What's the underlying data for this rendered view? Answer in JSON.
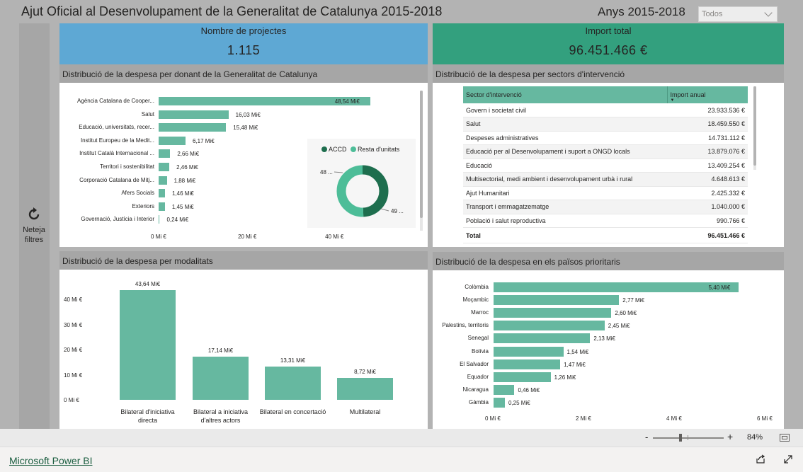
{
  "header": {
    "title": "Ajut Oficial al Desenvolupament de la Generalitat de Catalunya 2015-2018",
    "years_label": "Anys 2015-2018",
    "slicer_value": "Todos"
  },
  "reset": {
    "label_line1": "Neteja",
    "label_line2": "filtres",
    "icon": "refresh-icon"
  },
  "kpis": {
    "projects": {
      "title": "Nombre de projectes",
      "value": "1.115",
      "color": "#5ea8d4"
    },
    "total": {
      "title": "Import total",
      "value": "96.451.466 €",
      "color": "#33a07e"
    }
  },
  "sections": {
    "donors": "Distribució de la despesa per donant de la Generalitat de Catalunya",
    "sectors": "Distribució de la despesa per sectors d'intervenció",
    "modalities": "Distribució de la despesa per modalitats",
    "countries": "Distribució de la despesa en els països prioritaris"
  },
  "chart_data": [
    {
      "type": "bar",
      "orientation": "horizontal",
      "categories": [
        "Agència Catalana de Cooper...",
        "Salut",
        "Educació, universitats, recer...",
        "Institut Europeu de la Medit...",
        "Institut Català Internacional ...",
        "Territori i sostenibilitat",
        "Corporació Catalana de Mitj...",
        "Afers Socials",
        "Exteriors",
        "Governació, Justícia i Interior"
      ],
      "values": [
        48.54,
        16.03,
        15.48,
        6.17,
        2.66,
        2.46,
        1.88,
        1.46,
        1.45,
        0.24
      ],
      "value_labels": [
        "48,54 Mi€",
        "16,03 Mi€",
        "15,48 Mi€",
        "6,17 Mi€",
        "2,66 Mi€",
        "2,46 Mi€",
        "1,88 Mi€",
        "1,46 Mi€",
        "1,45 Mi€",
        "0,24 Mi€"
      ],
      "xticks": [
        "0 Mi €",
        "20 Mi €",
        "40 Mi €"
      ],
      "xlim": [
        0,
        52
      ]
    },
    {
      "type": "pie",
      "variant": "donut",
      "legend": [
        "ACCD",
        "Resta d'unitats"
      ],
      "values": [
        48,
        49
      ],
      "value_labels": [
        "48 ...",
        "49 ..."
      ],
      "colors": [
        "#1e6e4e",
        "#4dbd98"
      ]
    },
    {
      "type": "bar",
      "orientation": "vertical",
      "categories": [
        [
          "Bilateral d'iniciativa",
          "directa"
        ],
        [
          "Bilateral a iniciativa",
          "d'altres actors"
        ],
        [
          "Bilateral en concertació"
        ],
        [
          "Multilateral"
        ]
      ],
      "values": [
        43.64,
        17.14,
        13.31,
        8.72
      ],
      "value_labels": [
        "43,64 Mi€",
        "17,14 Mi€",
        "13,31 Mi€",
        "8,72 Mi€"
      ],
      "yticks": [
        "40 Mi €",
        "30 Mi €",
        "20 Mi €",
        "10 Mi €",
        "0 Mi €"
      ],
      "ylim": [
        0,
        45
      ]
    },
    {
      "type": "bar",
      "orientation": "horizontal",
      "categories": [
        "Colòmbia",
        "Moçambic",
        "Marroc",
        "Palestins, territoris",
        "Senegal",
        "Bolívia",
        "El Salvador",
        "Equador",
        "Nicaragua",
        "Gàmbia"
      ],
      "values": [
        5.4,
        2.77,
        2.6,
        2.45,
        2.13,
        1.54,
        1.47,
        1.26,
        0.46,
        0.25
      ],
      "value_labels": [
        "5,40 Mi€",
        "2,77 Mi€",
        "2,60 Mi€",
        "2,45 Mi€",
        "2,13 Mi€",
        "1,54 Mi€",
        "1,47 Mi€",
        "1,26 Mi€",
        "0,46 Mi€",
        "0,25 Mi€"
      ],
      "xticks": [
        "0 Mi €",
        "2 Mi €",
        "4 Mi €",
        "6 Mi €"
      ],
      "xlim": [
        0,
        6
      ]
    }
  ],
  "sectors_table": {
    "columns": [
      "Sector d'intervenció",
      "Import anual"
    ],
    "rows": [
      [
        "Govern i societat civil",
        "23.933.536 €"
      ],
      [
        "Salut",
        "18.459.550 €"
      ],
      [
        "Despeses administratives",
        "14.731.112 €"
      ],
      [
        "Educació per al Desenvolupament i suport a ONGD locals",
        "13.879.076 €"
      ],
      [
        "Educació",
        "13.409.254 €"
      ],
      [
        "Multisectorial, medi ambient i desenvolupament urbà i rural",
        "4.648.613 €"
      ],
      [
        "Ajut Humanitari",
        "2.425.332 €"
      ],
      [
        "Transport i emmagatzematge",
        "1.040.000 €"
      ],
      [
        "Població i salut reproductiva",
        "990.766 €"
      ]
    ],
    "total": [
      "Total",
      "96.451.466 €"
    ]
  },
  "footer": {
    "zoom_minus": "-",
    "zoom_plus": "+",
    "zoom_pct": "84%",
    "zoom_level": 0.84,
    "powerbi_link": "Microsoft Power BI"
  },
  "colors": {
    "bar": "#66b8a0",
    "header_gray": "#a6a6a6",
    "bg_gray": "#b3b3b3"
  }
}
